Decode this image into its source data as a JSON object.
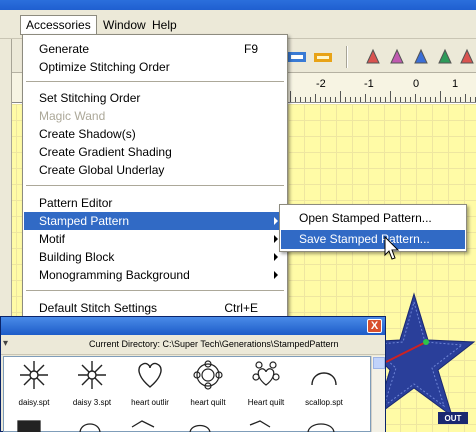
{
  "menubar": {
    "items": [
      {
        "label": "Accessories"
      },
      {
        "label": "Window"
      },
      {
        "label": "Help"
      }
    ]
  },
  "ruler": {
    "labels": [
      "-2",
      "-1",
      "0",
      "1"
    ]
  },
  "menu": {
    "items": [
      {
        "label": "Generate",
        "shortcut": "F9"
      },
      {
        "label": "Optimize Stitching Order"
      },
      {
        "label": "Set Stitching Order"
      },
      {
        "label": "Magic Wand",
        "disabled": true
      },
      {
        "label": "Create Shadow(s)"
      },
      {
        "label": "Create Gradient Shading"
      },
      {
        "label": "Create Global Underlay"
      },
      {
        "label": "Pattern Editor"
      },
      {
        "label": "Stamped Pattern",
        "highlighted": true
      },
      {
        "label": "Motif"
      },
      {
        "label": "Building Block"
      },
      {
        "label": "Monogramming Background"
      },
      {
        "label": "Default Stitch Settings",
        "shortcut": "Ctrl+E"
      }
    ]
  },
  "submenu": {
    "items": [
      {
        "label": "Open Stamped Pattern..."
      },
      {
        "label": "Save Stamped Pattern...",
        "highlighted": true
      }
    ]
  },
  "dialog": {
    "directory": "Current Directory: C:\\Super Tech\\Generations\\StampedPattern",
    "close_label": "X",
    "thumbnails": [
      {
        "label": "daisy.spt"
      },
      {
        "label": "daisy 3.spt"
      },
      {
        "label": "heart outlir"
      },
      {
        "label": "heart quilt"
      },
      {
        "label": "Heart quilt"
      },
      {
        "label": "scallop.spt"
      }
    ]
  },
  "badge": {
    "label": "OUT"
  },
  "colors": {
    "highlight": "#316ac5",
    "canvas": "#fffba6",
    "star": "#2a3f9a"
  }
}
